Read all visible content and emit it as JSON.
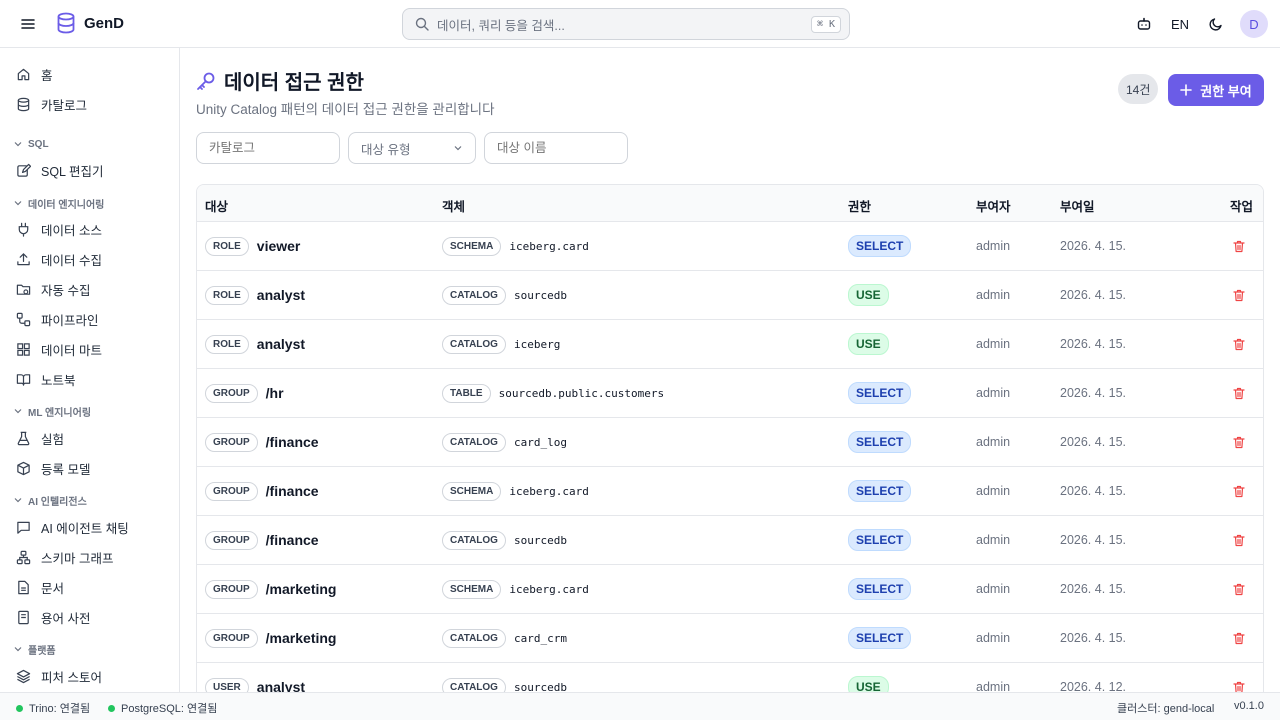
{
  "app": {
    "name": "GenD"
  },
  "search": {
    "placeholder": "데이터, 쿼리 등을 검색...",
    "shortcut": "⌘ K"
  },
  "header": {
    "lang": "EN",
    "avatar": "D"
  },
  "sidebar": {
    "home": "홈",
    "catalog": "카탈로그",
    "sec_sql": "SQL",
    "sql_editor": "SQL 편집기",
    "sec_data_eng": "데이터 엔지니어링",
    "data_sources": "데이터 소스",
    "data_ingest": "데이터 수집",
    "auto_ingest": "자동 수집",
    "pipeline": "파이프라인",
    "data_mart": "데이터 마트",
    "notebook": "노트북",
    "sec_ml": "ML 엔지니어링",
    "experiment": "실험",
    "registered_model": "등록 모델",
    "sec_ai": "AI 인텔리전스",
    "ai_agent_chat": "AI 에이전트 채팅",
    "schema_graph": "스키마 그래프",
    "docs": "문서",
    "glossary": "용어 사전",
    "sec_platform": "플랫폼",
    "feature_store": "피처 스토어"
  },
  "page": {
    "title": "데이터 접근 권한",
    "subtitle": "Unity Catalog 패턴의 데이터 접근 권한을 관리합니다",
    "count": "14건",
    "grant_button": "권한 부여"
  },
  "filters": {
    "catalog_placeholder": "카탈로그",
    "target_type": "대상 유형",
    "target_name_placeholder": "대상 이름"
  },
  "table": {
    "headers": {
      "target": "대상",
      "object": "객체",
      "permission": "권한",
      "grantor": "부여자",
      "granted_at": "부여일",
      "action": "작업"
    },
    "rows": [
      {
        "target_type": "ROLE",
        "target": "viewer",
        "object_type": "SCHEMA",
        "object": "iceberg.card",
        "permission": "SELECT",
        "grantor": "admin",
        "date": "2026. 4. 15."
      },
      {
        "target_type": "ROLE",
        "target": "analyst",
        "object_type": "CATALOG",
        "object": "sourcedb",
        "permission": "USE",
        "grantor": "admin",
        "date": "2026. 4. 15."
      },
      {
        "target_type": "ROLE",
        "target": "analyst",
        "object_type": "CATALOG",
        "object": "iceberg",
        "permission": "USE",
        "grantor": "admin",
        "date": "2026. 4. 15."
      },
      {
        "target_type": "GROUP",
        "target": "/hr",
        "object_type": "TABLE",
        "object": "sourcedb.public.customers",
        "permission": "SELECT",
        "grantor": "admin",
        "date": "2026. 4. 15."
      },
      {
        "target_type": "GROUP",
        "target": "/finance",
        "object_type": "CATALOG",
        "object": "card_log",
        "permission": "SELECT",
        "grantor": "admin",
        "date": "2026. 4. 15."
      },
      {
        "target_type": "GROUP",
        "target": "/finance",
        "object_type": "SCHEMA",
        "object": "iceberg.card",
        "permission": "SELECT",
        "grantor": "admin",
        "date": "2026. 4. 15."
      },
      {
        "target_type": "GROUP",
        "target": "/finance",
        "object_type": "CATALOG",
        "object": "sourcedb",
        "permission": "SELECT",
        "grantor": "admin",
        "date": "2026. 4. 15."
      },
      {
        "target_type": "GROUP",
        "target": "/marketing",
        "object_type": "SCHEMA",
        "object": "iceberg.card",
        "permission": "SELECT",
        "grantor": "admin",
        "date": "2026. 4. 15."
      },
      {
        "target_type": "GROUP",
        "target": "/marketing",
        "object_type": "CATALOG",
        "object": "card_crm",
        "permission": "SELECT",
        "grantor": "admin",
        "date": "2026. 4. 15."
      },
      {
        "target_type": "USER",
        "target": "analyst",
        "object_type": "CATALOG",
        "object": "sourcedb",
        "permission": "USE",
        "grantor": "admin",
        "date": "2026. 4. 12."
      }
    ]
  },
  "status": {
    "trino": "Trino: 연결됨",
    "postgres": "PostgreSQL: 연결됨",
    "cluster": "클러스터: gend-local",
    "version": "v0.1.0"
  },
  "colors": {
    "accent": "#6b5ce7",
    "select_bg": "#dbeafe",
    "use_bg": "#dcfce7",
    "delete": "#ef4444",
    "connected": "#22c55e"
  }
}
